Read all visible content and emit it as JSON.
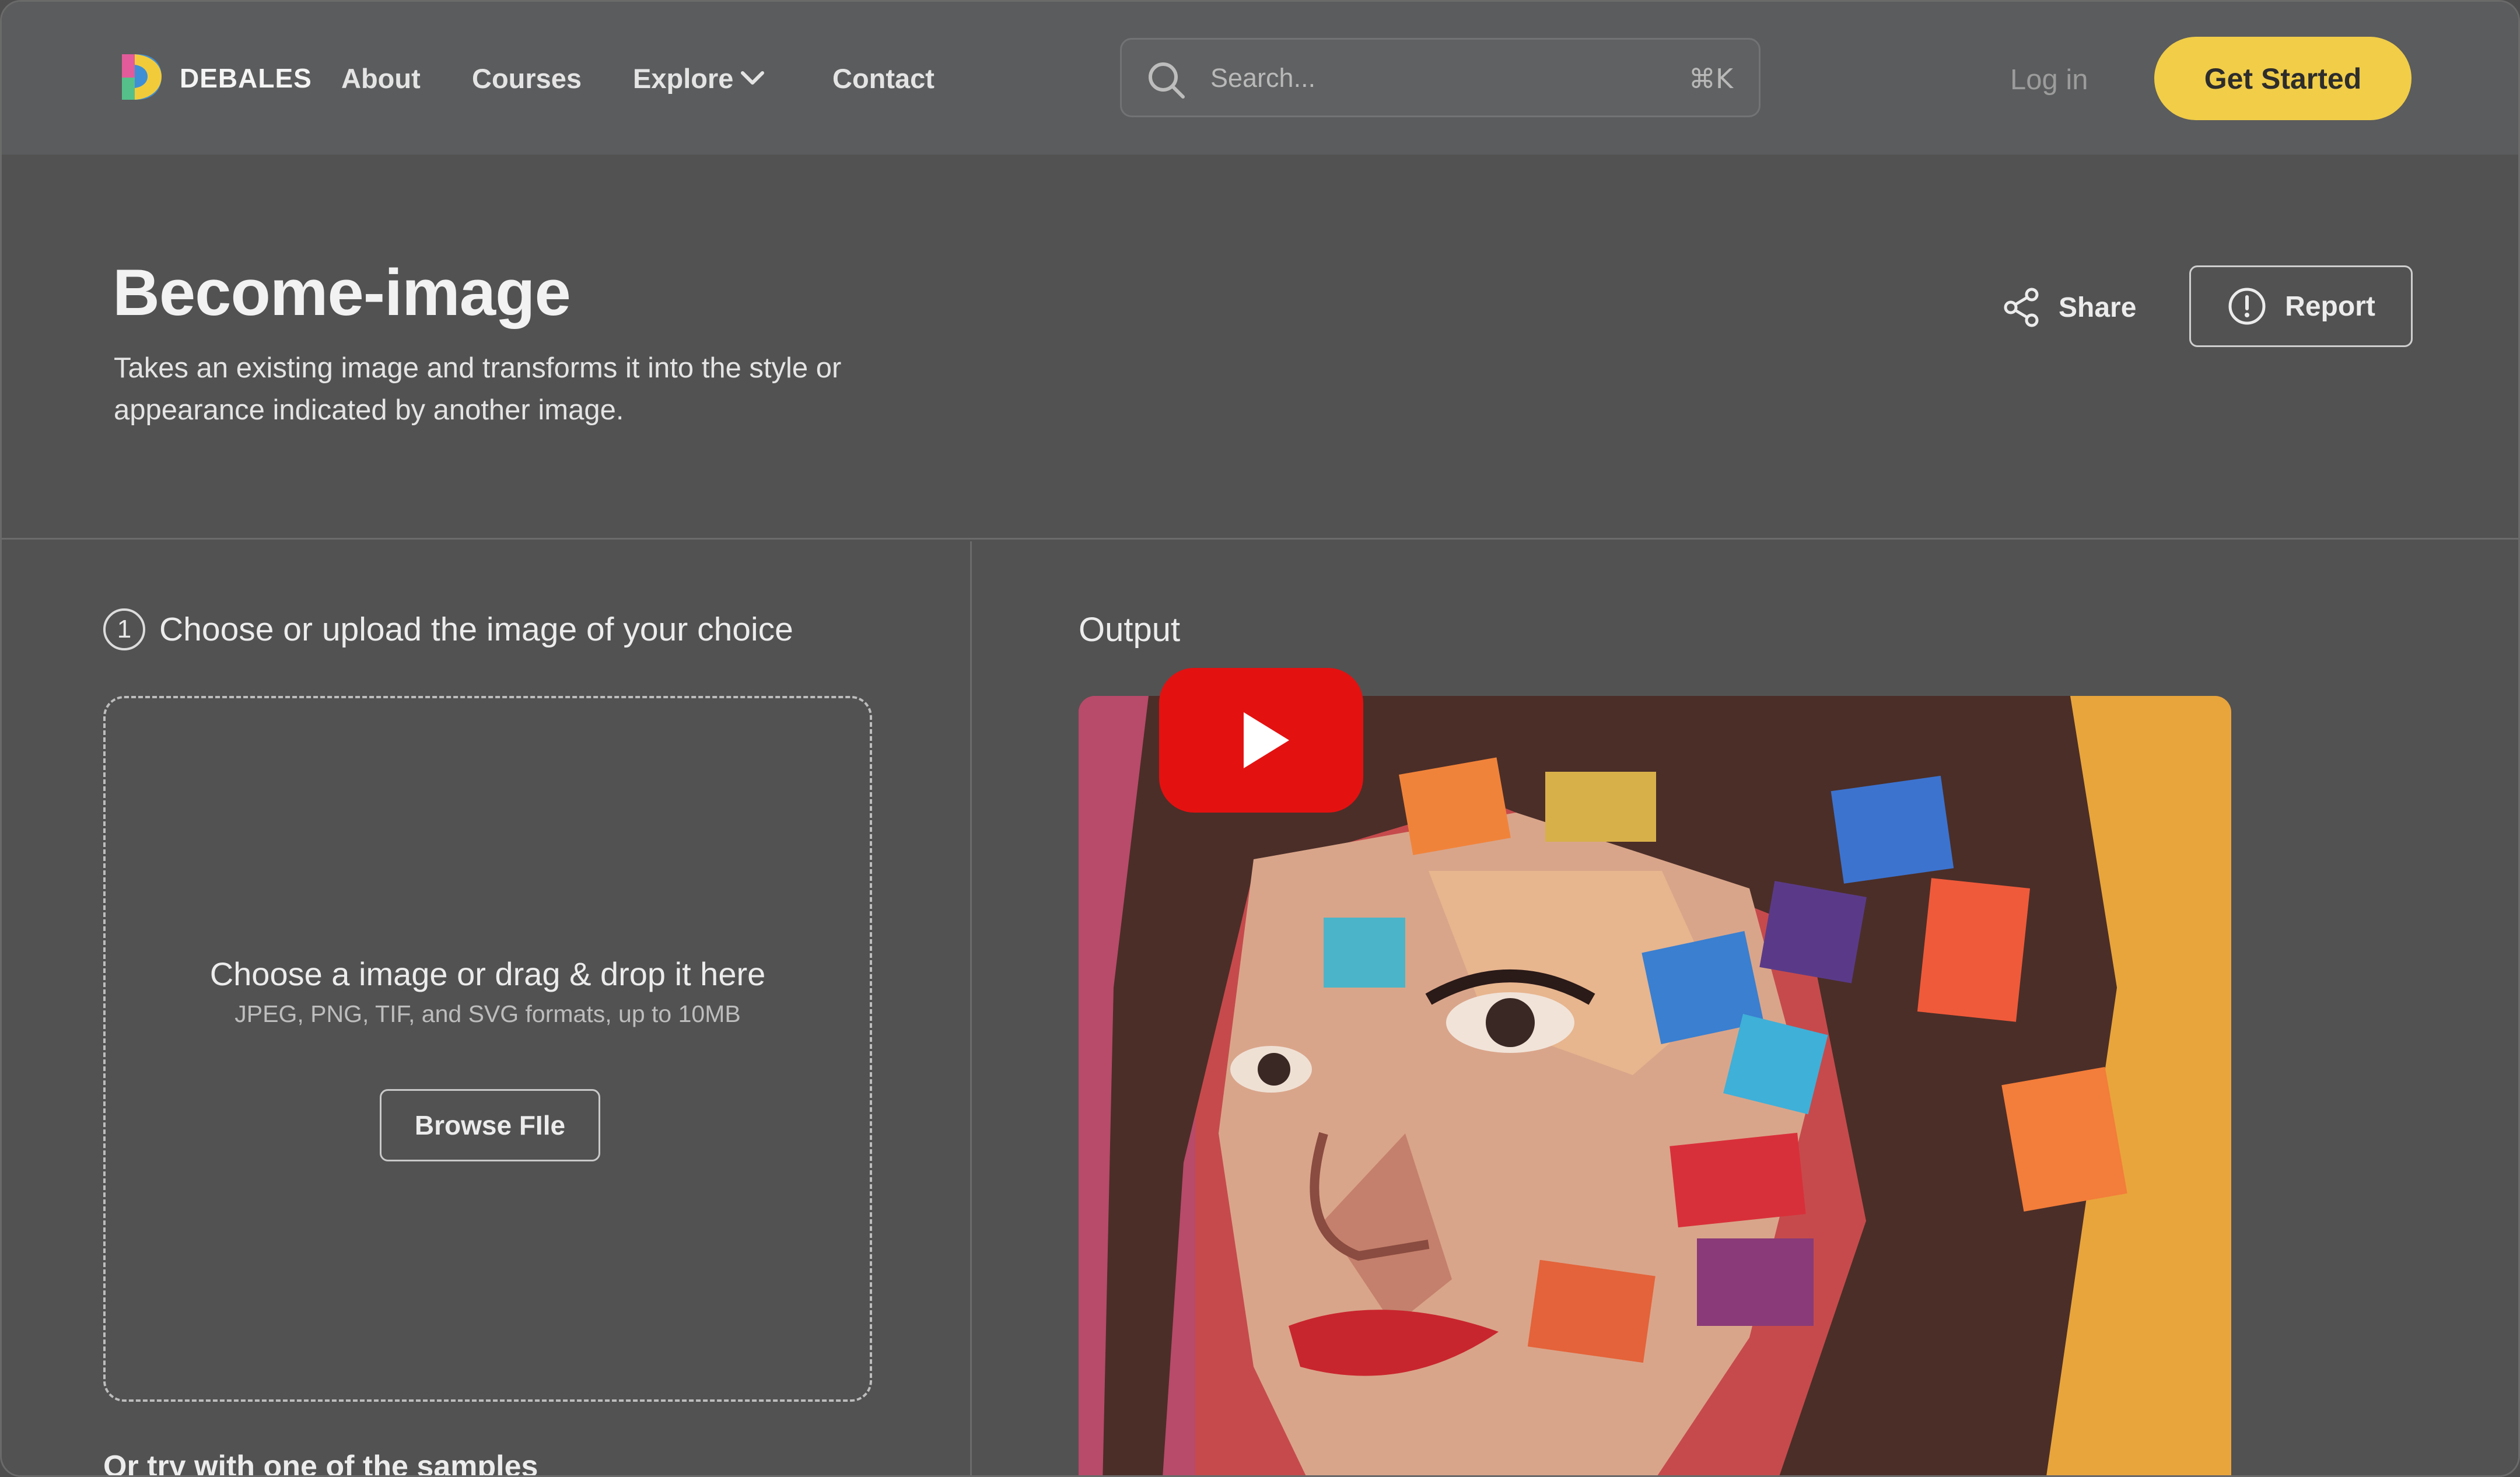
{
  "nav": {
    "brand": "DEBALES",
    "links": [
      "About",
      "Courses",
      "Explore",
      "Contact"
    ],
    "search_placeholder": "Search...",
    "search_shortcut": "⌘K",
    "login_label": "Log in",
    "cta_label": "Get Started"
  },
  "hero": {
    "title": "Become-image",
    "description": "Takes an existing image and transforms it into the style or appearance indicated by another image.",
    "share_label": "Share",
    "report_label": "Report"
  },
  "input": {
    "step_number": "1",
    "step_title": "Choose or upload the image of your choice",
    "drop_main": "Choose a image or drag & drop it here",
    "drop_formats": "JPEG, PNG, TIF, and SVG formats, up to 10MB",
    "browse_label": "Browse FIle",
    "samples_label": "Or try with one of the samples"
  },
  "output": {
    "label": "Output"
  },
  "colors": {
    "accent": "#f1cd48",
    "youtube_red": "#e41111"
  }
}
